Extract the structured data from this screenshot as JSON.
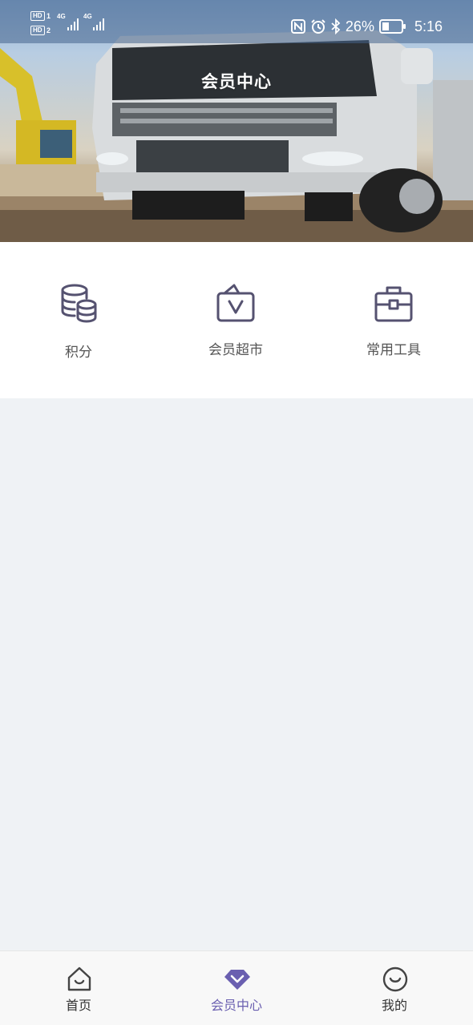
{
  "status_bar": {
    "sim1_badge": "HD",
    "sim1_number": "1",
    "sim2_badge": "HD",
    "sim2_number": "2",
    "sim1_network": "4G",
    "sim2_network": "4G",
    "battery_percent": "26%",
    "time": "5:16"
  },
  "header": {
    "title": "会员中心"
  },
  "features": [
    {
      "label": "积分",
      "icon": "coins-database-icon"
    },
    {
      "label": "会员超市",
      "icon": "shopping-bag-icon"
    },
    {
      "label": "常用工具",
      "icon": "toolbox-icon"
    }
  ],
  "tabbar": {
    "items": [
      {
        "label": "首页",
        "icon": "home-icon",
        "active": false
      },
      {
        "label": "会员中心",
        "icon": "diamond-icon",
        "active": true
      },
      {
        "label": "我的",
        "icon": "smile-face-icon",
        "active": false
      }
    ]
  },
  "colors": {
    "icon_stroke": "#555270",
    "active_tab": "#6a5fb0",
    "page_bg": "#eff2f5"
  }
}
